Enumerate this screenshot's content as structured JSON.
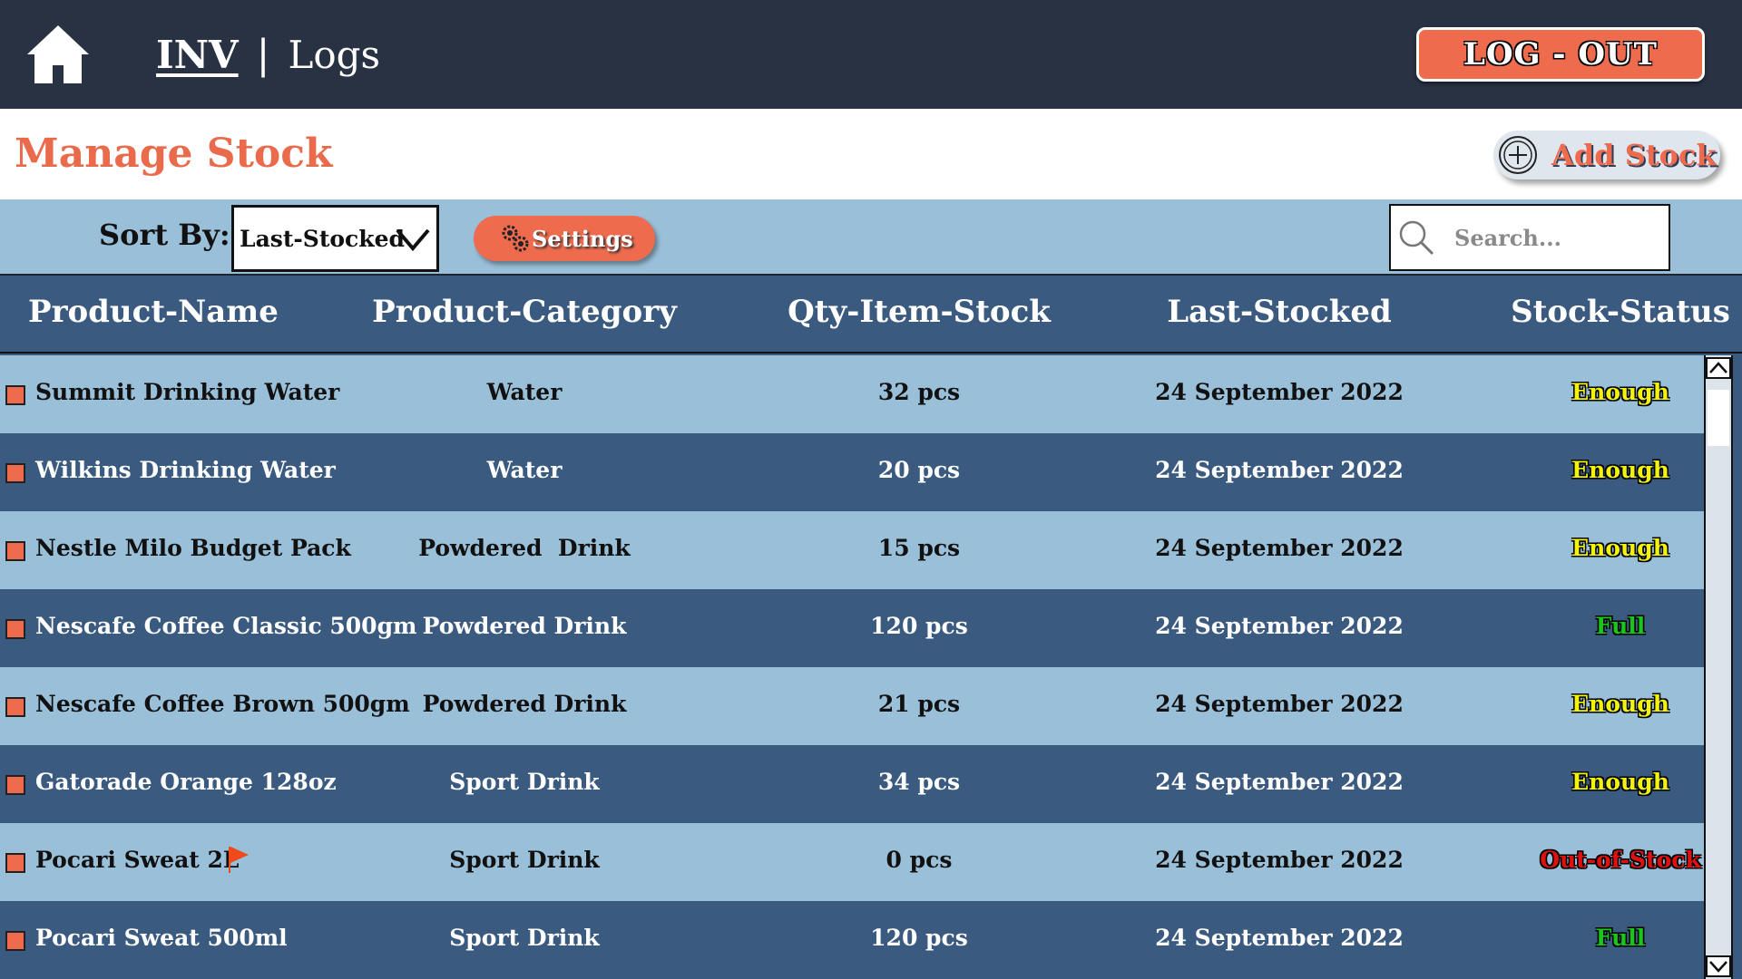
{
  "nav": {
    "home_icon": "home-icon",
    "brand": "INV",
    "separator": "|",
    "section": "Logs",
    "logout_label": "LOG - OUT"
  },
  "header": {
    "title": "Manage Stock",
    "add_stock_label": "Add Stock",
    "add_stock_icon": "plus-circle-icon"
  },
  "toolbar": {
    "sort_label": "Sort By:",
    "sort_value": "Last-Stocked",
    "settings_label": "Settings",
    "settings_icon": "gears-icon",
    "search_placeholder": "Search..."
  },
  "table": {
    "columns": [
      "Product-Name",
      "Product-Category",
      "Qty-Item-Stock",
      "Last-Stocked",
      "Stock-Status"
    ],
    "rows": [
      {
        "name": "Summit Drinking Water",
        "category": "Water",
        "qty": "32 pcs",
        "date": "24 September 2022",
        "status": "Enough"
      },
      {
        "name": "Wilkins Drinking Water",
        "category": "Water",
        "qty": "20 pcs",
        "date": "24 September 2022",
        "status": "Enough"
      },
      {
        "name": "Nestle Milo Budget Pack",
        "category": "Powdered  Drink",
        "qty": "15 pcs",
        "date": "24 September 2022",
        "status": "Enough"
      },
      {
        "name": "Nescafe Coffee Classic 500gm",
        "category": "Powdered Drink",
        "qty": "120 pcs",
        "date": "24 September 2022",
        "status": "Full"
      },
      {
        "name": "Nescafe Coffee Brown 500gm",
        "category": "Powdered Drink",
        "qty": "21 pcs",
        "date": "24 September 2022",
        "status": "Enough"
      },
      {
        "name": "Gatorade Orange 128oz",
        "category": "Sport Drink",
        "qty": "34 pcs",
        "date": "24 September 2022",
        "status": "Enough"
      },
      {
        "name": "Pocari Sweat 2L",
        "category": "Sport Drink",
        "qty": "0 pcs",
        "date": "24 September 2022",
        "status": "Out-of-Stock",
        "flagged": true
      },
      {
        "name": "Pocari Sweat 500ml",
        "category": "Sport Drink",
        "qty": "120 pcs",
        "date": "24 September 2022",
        "status": "Full"
      }
    ]
  },
  "colors": {
    "topbar": "#293243",
    "accent": "#ef6b4d",
    "row_light": "#99bfd9",
    "row_dark": "#3b5a80",
    "status_enough": "#f2f20a",
    "status_full": "#18c818",
    "status_out": "#e01010"
  }
}
